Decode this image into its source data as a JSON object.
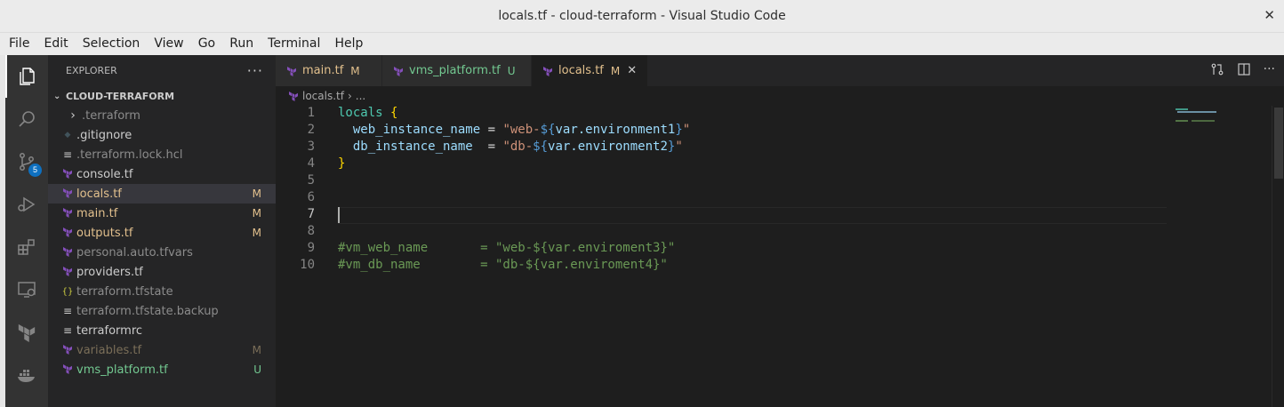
{
  "window": {
    "title": "locals.tf - cloud-terraform - Visual Studio Code",
    "close_glyph": "✕"
  },
  "menu": [
    "File",
    "Edit",
    "Selection",
    "View",
    "Go",
    "Run",
    "Terminal",
    "Help"
  ],
  "activity_bar": {
    "items": [
      "explorer-icon",
      "search-icon",
      "source-control-icon",
      "run-debug-icon",
      "extensions-icon",
      "remote-explorer-icon",
      "terraform-icon",
      "docker-icon"
    ],
    "scm_badge": "5"
  },
  "explorer": {
    "title": "EXPLORER",
    "more": "···",
    "folder": "CLOUD-TERRAFORM",
    "files": [
      {
        "name": ".terraform",
        "icon": "chevron",
        "status": "",
        "color": "#8c8c8c"
      },
      {
        "name": ".gitignore",
        "icon": "gitignore",
        "status": "",
        "color": "#cccccc"
      },
      {
        "name": ".terraform.lock.hcl",
        "icon": "lines",
        "status": "",
        "color": "#8c8c8c"
      },
      {
        "name": "console.tf",
        "icon": "terraform",
        "status": "",
        "color": "#cccccc"
      },
      {
        "name": "locals.tf",
        "icon": "terraform",
        "status": "M",
        "color": "#e2c08d"
      },
      {
        "name": "main.tf",
        "icon": "terraform",
        "status": "M",
        "color": "#e2c08d"
      },
      {
        "name": "outputs.tf",
        "icon": "terraform",
        "status": "M",
        "color": "#e2c08d"
      },
      {
        "name": "personal.auto.tfvars",
        "icon": "terraform",
        "status": "",
        "color": "#8c8c8c"
      },
      {
        "name": "providers.tf",
        "icon": "terraform",
        "status": "",
        "color": "#cccccc"
      },
      {
        "name": "terraform.tfstate",
        "icon": "json",
        "status": "",
        "color": "#8c8c8c"
      },
      {
        "name": "terraform.tfstate.backup",
        "icon": "lines",
        "status": "",
        "color": "#8c8c8c"
      },
      {
        "name": "terraformrc",
        "icon": "lines",
        "status": "",
        "color": "#cccccc"
      },
      {
        "name": "variables.tf",
        "icon": "terraform",
        "status": "M",
        "color": "#7a6e58"
      },
      {
        "name": "vms_platform.tf",
        "icon": "terraform",
        "status": "U",
        "color": "#73c991"
      }
    ]
  },
  "tabs": [
    {
      "label": "main.tf",
      "status": "M",
      "color": "#e2c08d"
    },
    {
      "label": "vms_platform.tf",
      "status": "U",
      "color": "#73c991"
    },
    {
      "label": "locals.tf",
      "status": "M",
      "color": "#e2c08d",
      "close": "✕"
    }
  ],
  "breadcrumb": {
    "file": "locals.tf",
    "sep": "›",
    "rest": "..."
  },
  "code": {
    "current_line": 7,
    "lines": [
      [
        [
          "locals",
          "#4ec9b0"
        ],
        [
          " ",
          "#d4d4d4"
        ],
        [
          "{",
          "#ffd700"
        ]
      ],
      [
        [
          "  ",
          "#d4d4d4"
        ],
        [
          "web_instance_name",
          "#9cdcfe"
        ],
        [
          " = ",
          "#d4d4d4"
        ],
        [
          "\"web-",
          "#ce9178"
        ],
        [
          "${",
          "#569cd6"
        ],
        [
          "var.environment1",
          "#9cdcfe"
        ],
        [
          "}",
          "#569cd6"
        ],
        [
          "\"",
          "#ce9178"
        ]
      ],
      [
        [
          "  ",
          "#d4d4d4"
        ],
        [
          "db_instance_name",
          "#9cdcfe"
        ],
        [
          "  = ",
          "#d4d4d4"
        ],
        [
          "\"db-",
          "#ce9178"
        ],
        [
          "${",
          "#569cd6"
        ],
        [
          "var.environment2",
          "#9cdcfe"
        ],
        [
          "}",
          "#569cd6"
        ],
        [
          "\"",
          "#ce9178"
        ]
      ],
      [
        [
          "}",
          "#ffd700"
        ]
      ],
      [],
      [],
      [],
      [],
      [
        [
          "#vm_web_name       = \"web-${var.enviroment3}\"",
          "#6a9955"
        ]
      ],
      [
        [
          "#vm_db_name        = \"db-${var.enviroment4}\"",
          "#6a9955"
        ]
      ]
    ]
  },
  "colors": {
    "accent": "#0e70c0",
    "terraform": "#844fba"
  }
}
